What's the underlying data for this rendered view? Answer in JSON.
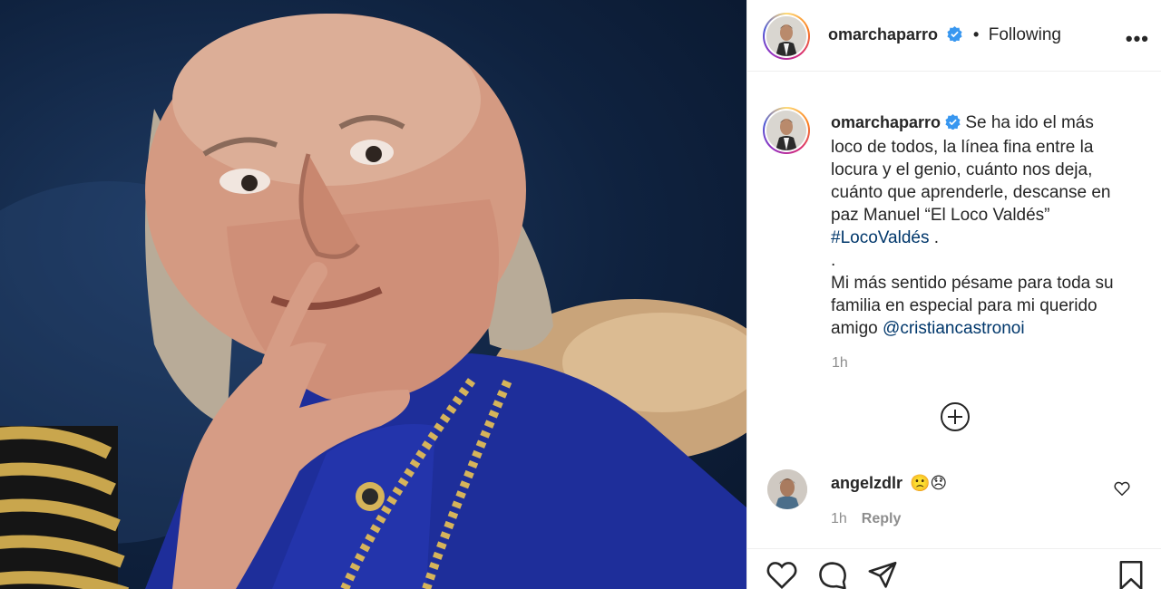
{
  "post": {
    "author": "omarchaparro",
    "verified": true,
    "follow_status": "Following",
    "more_label": "•••"
  },
  "caption": {
    "username": "omarchaparro",
    "lines": [
      "Se ha ido el más",
      "loco de todos, la línea fina entre la",
      "locura y el genio, cuánto nos deja,",
      "cuánto que aprenderle, descanse en",
      "paz Manuel “El Loco Valdés”"
    ],
    "hashtag": "#LocoValdés",
    "hashtag_suffix": " .",
    "dot_line": ".",
    "lines2": [
      "Mi más sentido pésame para toda su",
      "familia en especial para mi querido"
    ],
    "mention_prefix": "amigo ",
    "mention": "@cristiancastronoi",
    "time": "1h"
  },
  "comments": [
    {
      "username": "angelzdlr",
      "text": "🙁😞",
      "time": "1h",
      "reply_label": "Reply"
    }
  ],
  "icons": {
    "verified": "verified-badge-icon",
    "more": "more-options-icon",
    "load_more": "plus-circle-icon",
    "like_comment": "heart-icon",
    "like": "heart-icon",
    "comment": "comment-icon",
    "share": "paper-plane-icon",
    "save": "bookmark-icon"
  },
  "colors": {
    "accent_link": "#00376b",
    "verified_blue": "#3897f0",
    "muted": "#8e8e8e",
    "text": "#262626"
  }
}
